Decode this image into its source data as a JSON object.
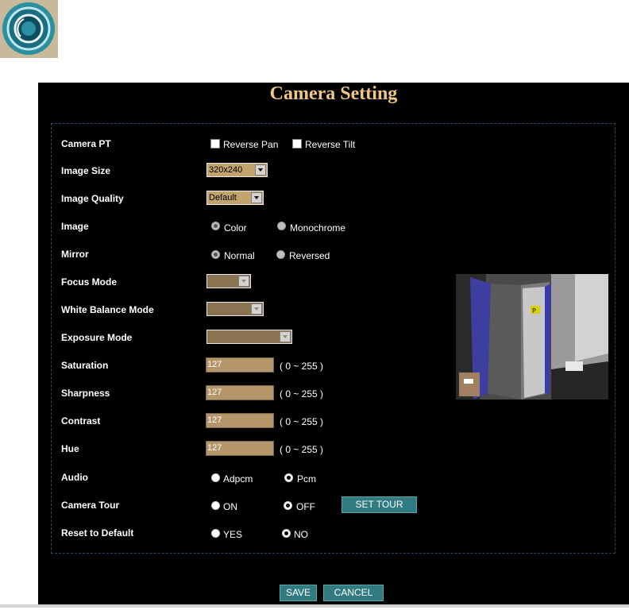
{
  "page": {
    "title": "Camera Setting"
  },
  "camera_pt": {
    "label": "Camera PT",
    "reverse_pan": {
      "label": "Reverse Pan",
      "checked": false
    },
    "reverse_tilt": {
      "label": "Reverse Tilt",
      "checked": false
    }
  },
  "image_size": {
    "label": "Image Size",
    "value": "320x240"
  },
  "image_quality": {
    "label": "Image Quality",
    "value": "Default"
  },
  "image": {
    "label": "Image",
    "options": [
      "Color",
      "Monochrome"
    ],
    "selected": "Color"
  },
  "mirror": {
    "label": "Mirror",
    "options": [
      "Normal",
      "Reversed"
    ],
    "selected": "Normal"
  },
  "focus_mode": {
    "label": "Focus Mode",
    "disabled": true
  },
  "white_balance_mode": {
    "label": "White Balance Mode",
    "disabled": true
  },
  "exposure_mode": {
    "label": "Exposure Mode",
    "disabled": true
  },
  "saturation": {
    "label": "Saturation",
    "value": "127",
    "range": "( 0 ~ 255 )"
  },
  "sharpness": {
    "label": "Sharpness",
    "value": "127",
    "range": "( 0 ~ 255 )"
  },
  "contrast": {
    "label": "Contrast",
    "value": "127",
    "range": "( 0 ~ 255 )"
  },
  "hue": {
    "label": "Hue",
    "value": "127",
    "range": "( 0 ~ 255 )"
  },
  "audio": {
    "label": "Audio",
    "options": [
      "Adpcm",
      "Pcm"
    ],
    "selected": "Pcm"
  },
  "camera_tour": {
    "label": "Camera Tour",
    "options": [
      "ON",
      "OFF"
    ],
    "selected": "OFF",
    "set_tour_label": "SET TOUR"
  },
  "reset_default": {
    "label": "Reset to Default",
    "options": [
      "YES",
      "NO"
    ],
    "selected": "NO"
  },
  "footer": {
    "save_label": "SAVE",
    "cancel_label": "CANCEL"
  },
  "preview": {
    "sign_text": "P"
  },
  "colors": {
    "panel_bg": "#000000",
    "title": "#f0c880",
    "input_bg": "#b5966a",
    "button_bg": "#2f7b7f"
  }
}
